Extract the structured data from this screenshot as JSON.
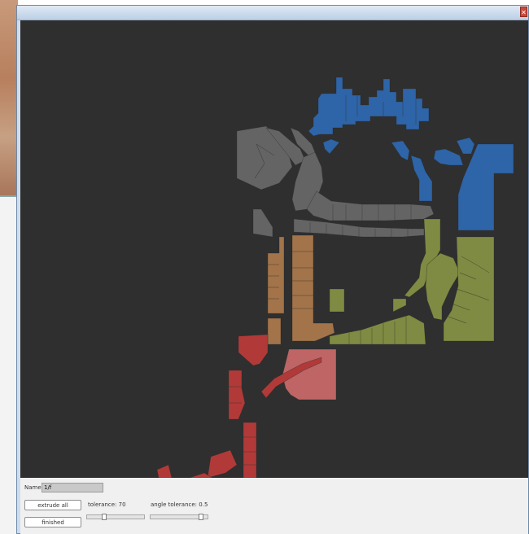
{
  "window": {
    "close_icon": "close-icon"
  },
  "controls": {
    "name_label": "Name:",
    "name_value": "1/f",
    "extrude_label": "extrude all",
    "finished_label": "finished",
    "tolerance_label": "tolerance: 70",
    "angle_tolerance_label": "angle tolerance: 0.5",
    "tolerance_level": 0.28,
    "angle_tolerance_level": 0.92
  },
  "colors": {
    "canvas_bg": "#2f2f2f",
    "blue": "#2e64a8",
    "gray": "#646464",
    "tan": "#a3744a",
    "green": "#7f8b42",
    "red": "#b13a39",
    "pink": "#bf6566"
  }
}
